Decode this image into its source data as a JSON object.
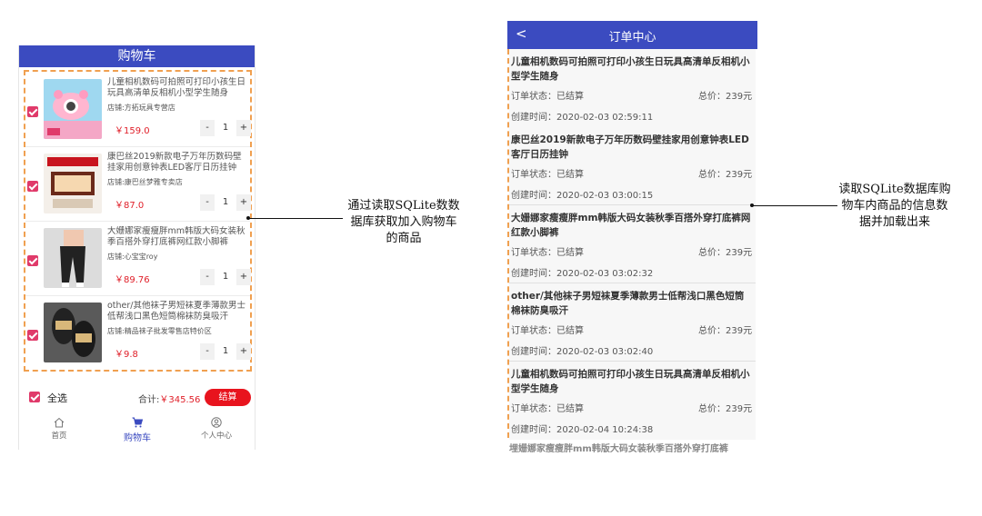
{
  "cart": {
    "header_title": "购物车",
    "items": [
      {
        "title": "儿童相机数码可拍照可打印小孩生日玩具高清单反相机小型学生随身",
        "shop": "店铺:方拓玩具专营店",
        "price": "￥159.0",
        "qty": "1",
        "checked": true
      },
      {
        "title": "康巴丝2019新款电子万年历数码壁挂家用创意钟表LED客厅日历挂钟",
        "shop": "店铺:康巴丝梦雅专卖店",
        "price": "￥87.0",
        "qty": "1",
        "checked": true
      },
      {
        "title": "大姗娜家瘦瘦胖mm韩版大码女装秋季百搭外穿打底裤网红款小脚裤",
        "shop": "店铺:心宝宝roy",
        "price": "￥89.76",
        "qty": "1",
        "checked": true
      },
      {
        "title": "other/其他袜子男短袜夏季薄款男士低帮浅口黑色短筒棉袜防臭吸汗",
        "shop": "店铺:精品袜子批发零售店特价区",
        "price": "￥9.8",
        "qty": "1",
        "checked": true
      }
    ],
    "minus": "-",
    "plus": "+",
    "select_all_label": "全选",
    "total_label": "合计:",
    "total_value": "￥345.56",
    "checkout_label": "结算",
    "tabs": [
      {
        "label": "首页",
        "icon": "home-icon"
      },
      {
        "label": "购物车",
        "icon": "cart-icon"
      },
      {
        "label": "个人中心",
        "icon": "person-icon"
      }
    ],
    "accent_color": "#3b4bc0",
    "price_color": "#e0202a"
  },
  "orders": {
    "back_glyph": "<",
    "header_title": "订单中心",
    "items": [
      {
        "title": "儿童相机数码可拍照可打印小孩生日玩具高清单反相机小型学生随身",
        "status": "订单状态：已结算",
        "price": "总价：239元",
        "time": "创建时间：2020-02-03 02:59:11"
      },
      {
        "title": "康巴丝2019新款电子万年历数码壁挂家用创意钟表LED客厅日历挂钟",
        "status": "订单状态：已结算",
        "price": "总价：239元",
        "time": "创建时间：2020-02-03 03:00:15"
      },
      {
        "title": "大姗娜家瘦瘦胖mm韩版大码女装秋季百搭外穿打底裤网红款小脚裤",
        "status": "订单状态：已结算",
        "price": "总价：239元",
        "time": "创建时间：2020-02-03 03:02:32"
      },
      {
        "title": "other/其他袜子男短袜夏季薄款男士低帮浅口黑色短筒棉袜防臭吸汗",
        "status": "订单状态：已结算",
        "price": "总价：239元",
        "time": "创建时间：2020-02-03 03:02:40"
      },
      {
        "title": "儿童相机数码可拍照可打印小孩生日玩具高清单反相机小型学生随身",
        "status": "订单状态：已结算",
        "price": "总价：239元",
        "time": "创建时间：2020-02-04 10:24:38"
      }
    ],
    "peek_title": "埋姗娜家瘦瘦胖mm韩版大码女装秋季百搭外穿打底裤"
  },
  "annotations": {
    "left_lines": [
      "通过读取SQLite数数",
      "据库获取加入购物车",
      "的商品"
    ],
    "right_lines": [
      "读取SQLite数据库购",
      "物车内商品的信息数",
      "据并加载出来"
    ]
  }
}
